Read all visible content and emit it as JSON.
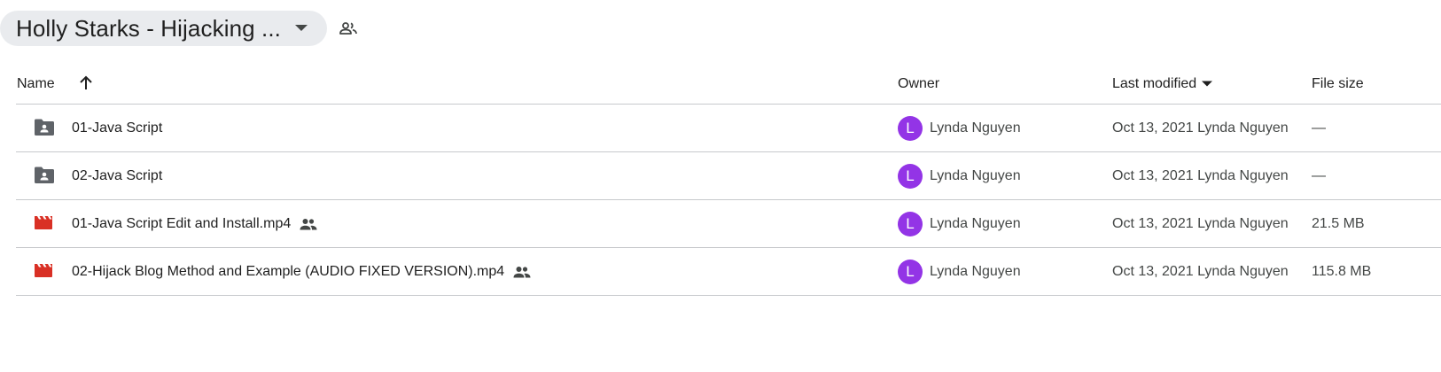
{
  "header": {
    "folder_title": "Holly Starks - Hijacking ...",
    "caret_icon": "arrow-drop-down-icon",
    "people_icon": "people-outline-icon"
  },
  "columns": {
    "name": "Name",
    "owner": "Owner",
    "last_modified": "Last modified",
    "file_size": "File size"
  },
  "colors": {
    "avatar": "#9334e6",
    "video_icon": "#d93025",
    "folder_icon": "#5f6368"
  },
  "rows": [
    {
      "type": "folder",
      "icon": "shared-folder-icon",
      "name": "01-Java Script",
      "shared": false,
      "owner_initial": "L",
      "owner": "Lynda Nguyen",
      "modified": "Oct 13, 2021 Lynda Nguyen",
      "size": "—"
    },
    {
      "type": "folder",
      "icon": "shared-folder-icon",
      "name": "02-Java Script",
      "shared": false,
      "owner_initial": "L",
      "owner": "Lynda Nguyen",
      "modified": "Oct 13, 2021 Lynda Nguyen",
      "size": "—"
    },
    {
      "type": "video",
      "icon": "video-file-icon",
      "name": "01-Java Script Edit and Install.mp4",
      "shared": true,
      "owner_initial": "L",
      "owner": "Lynda Nguyen",
      "modified": "Oct 13, 2021 Lynda Nguyen",
      "size": "21.5 MB"
    },
    {
      "type": "video",
      "icon": "video-file-icon",
      "name": "02-Hijack Blog Method and Example (AUDIO FIXED VERSION).mp4",
      "shared": true,
      "owner_initial": "L",
      "owner": "Lynda Nguyen",
      "modified": "Oct 13, 2021 Lynda Nguyen",
      "size": "115.8 MB"
    }
  ]
}
